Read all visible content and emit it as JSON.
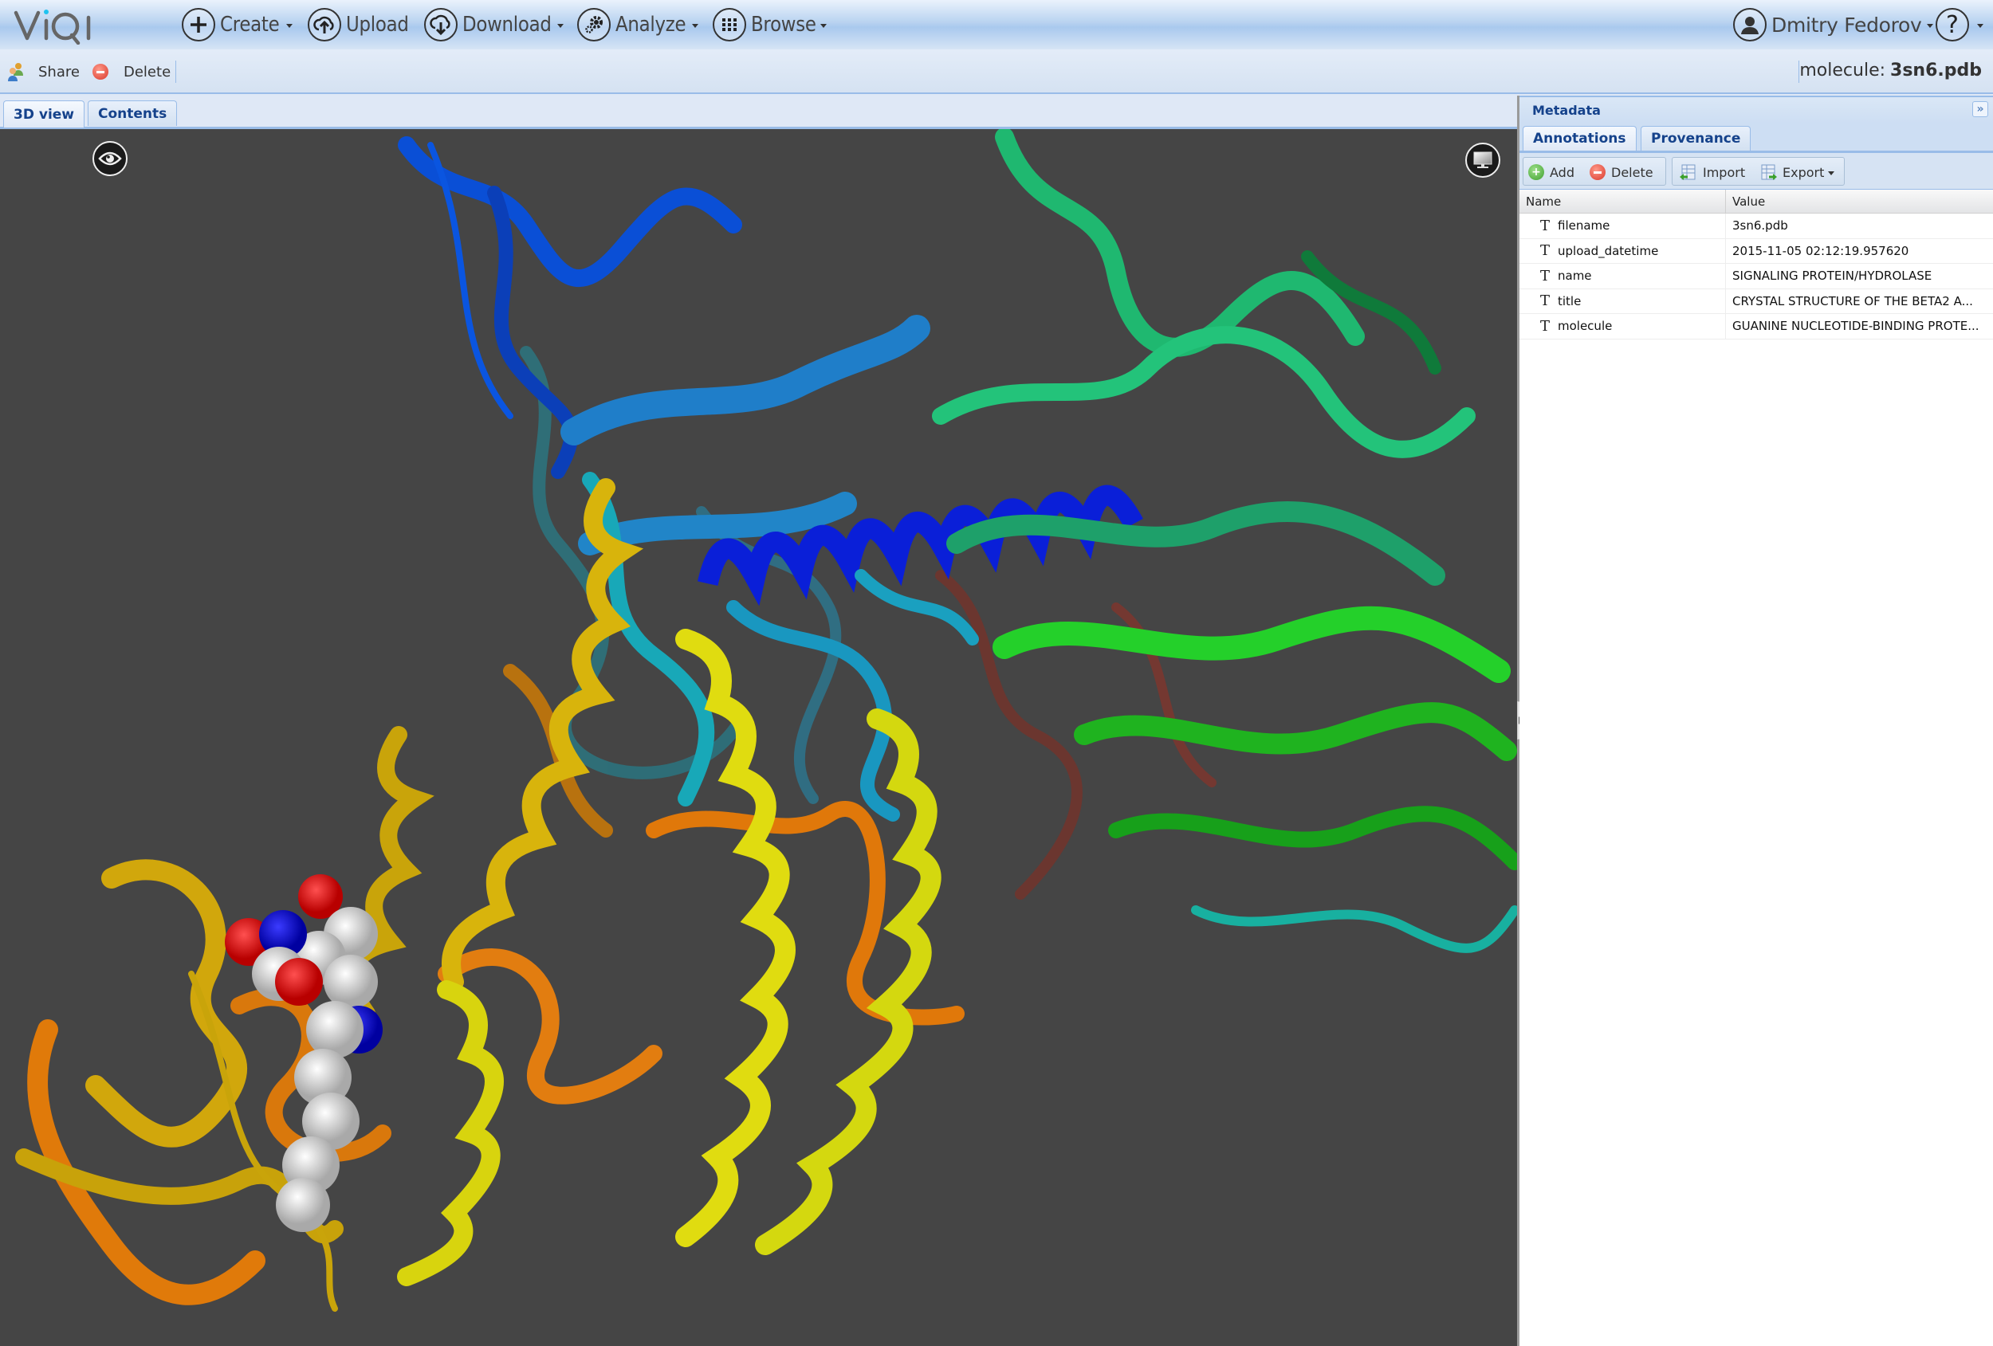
{
  "app": {
    "logo": "ViQi",
    "accent_color": "#15428b",
    "logo_dot_color": "#1fc3f0"
  },
  "nav": {
    "items": [
      {
        "label": "Create",
        "icon": "plus-icon",
        "has_menu": true
      },
      {
        "label": "Upload",
        "icon": "cloud-upload-icon",
        "has_menu": false
      },
      {
        "label": "Download",
        "icon": "cloud-download-icon",
        "has_menu": true
      },
      {
        "label": "Analyze",
        "icon": "gears-icon",
        "has_menu": true
      },
      {
        "label": "Browse",
        "icon": "grid-icon",
        "has_menu": true
      }
    ],
    "user": {
      "label": "Dmitry Fedorov",
      "icon": "user-icon"
    },
    "help": {
      "icon": "help-icon"
    }
  },
  "toolbar": {
    "share_label": "Share",
    "delete_label": "Delete",
    "resource_type": "molecule:",
    "resource_name": "3sn6.pdb"
  },
  "view_tabs": [
    {
      "label": "3D view",
      "active": true
    },
    {
      "label": "Contents",
      "active": false
    }
  ],
  "viewer": {
    "background": "#454545",
    "controls": [
      {
        "name": "visibility",
        "icon": "eye-icon"
      },
      {
        "name": "display",
        "icon": "monitor-icon"
      }
    ]
  },
  "metadata": {
    "title": "Metadata",
    "tabs": [
      {
        "label": "Annotations",
        "active": true
      },
      {
        "label": "Provenance",
        "active": false
      }
    ],
    "toolbar": {
      "add_label": "Add",
      "delete_label": "Delete",
      "import_label": "Import",
      "export_label": "Export"
    },
    "columns": [
      "Name",
      "Value"
    ],
    "rows": [
      {
        "name": "filename",
        "value": "3sn6.pdb"
      },
      {
        "name": "upload_datetime",
        "value": "2015-11-05 02:12:19.957620"
      },
      {
        "name": "name",
        "value": "SIGNALING PROTEIN/HYDROLASE"
      },
      {
        "name": "title",
        "value": "CRYSTAL STRUCTURE OF THE BETA2 A..."
      },
      {
        "name": "molecule",
        "value": "GUANINE NUCLEOTIDE-BINDING PROTE..."
      }
    ]
  }
}
